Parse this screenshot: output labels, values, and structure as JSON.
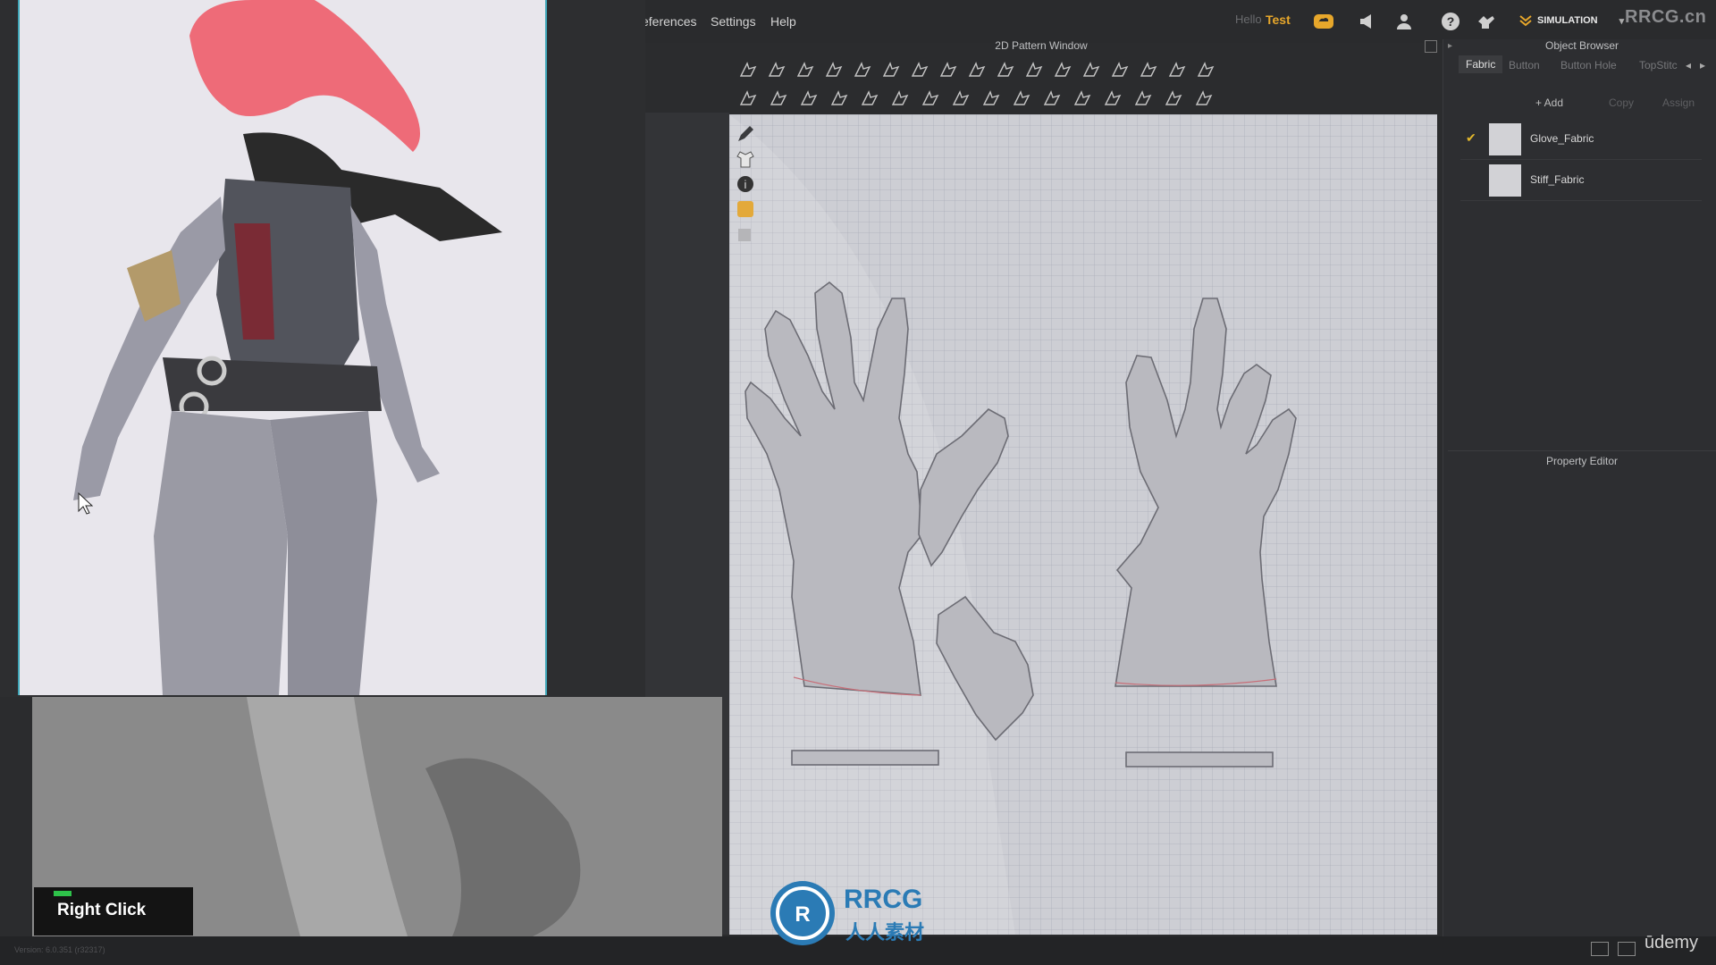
{
  "menu": {
    "preferences": "eferences",
    "settings": "Settings",
    "help": "Help"
  },
  "topbar": {
    "hello": "Hello",
    "user": "Test",
    "mode": "SIMULATION",
    "brand": "RRCG.cn"
  },
  "pattern_window": {
    "title": "2D Pattern Window"
  },
  "object_browser": {
    "title": "Object Browser",
    "tabs": [
      "Fabric",
      "Button",
      "Button Hole",
      "TopStitc"
    ],
    "actions": {
      "add": "+ Add",
      "copy": "Copy",
      "assign": "Assign"
    },
    "fabrics": [
      {
        "name": "Glove_Fabric",
        "selected": true
      },
      {
        "name": "Stiff_Fabric",
        "selected": false
      }
    ]
  },
  "property_editor": {
    "title": "Property Editor"
  },
  "hint": {
    "label": "Right Click"
  },
  "status": {
    "version": "Version: 6.0.351 (r32317)"
  },
  "footer": {
    "udemy": "ūdemy"
  },
  "watermark": {
    "brand_top": "RRCG",
    "brand_bottom": "人人素材"
  },
  "colors": {
    "accent": "#e7a72b",
    "hint_green": "#2ec24a",
    "canvas": "#cdced4",
    "ref_border": "#3fa6b8"
  }
}
